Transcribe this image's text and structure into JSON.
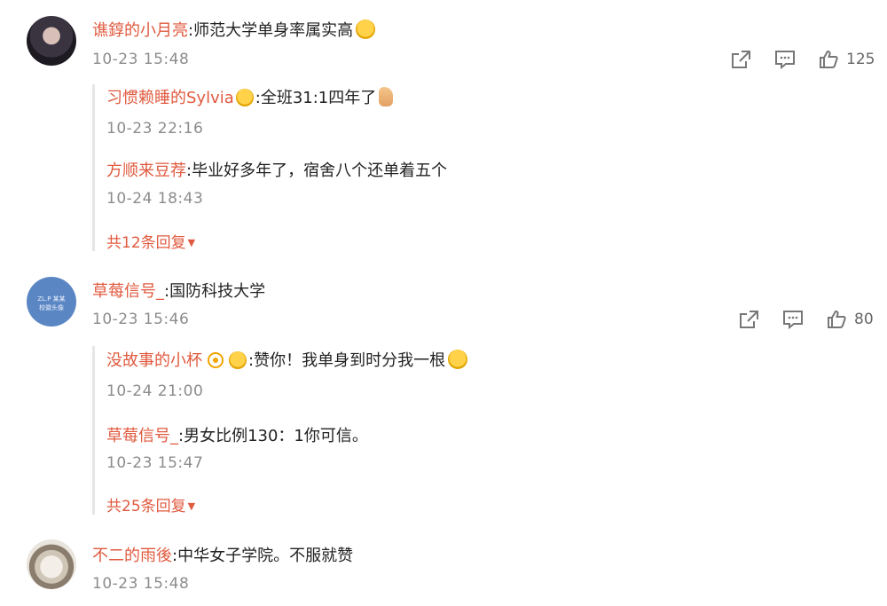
{
  "comments": [
    {
      "username": "谯錞的小月亮",
      "text": ":师范大学单身率属实高",
      "time": "10-23 15:48",
      "likes": "125",
      "replies": [
        {
          "username": "习惯赖睡的Sylvia",
          "text": ":全班31:1四年了",
          "time": "10-23 22:16"
        },
        {
          "username": "方顺来豆荐",
          "text": ":毕业好多年了，宿舍八个还单着五个",
          "time": "10-24 18:43"
        }
      ],
      "more_replies": "共12条回复"
    },
    {
      "username": "草莓信号_",
      "text": ":国防科技大学",
      "time": "10-23 15:46",
      "likes": "80",
      "avatar_text": "ZL.P 某某\n校徽头像",
      "replies": [
        {
          "username": "没故事的小杯",
          "text": ":赞你！我单身到时分我一根",
          "time": "10-24 21:00"
        },
        {
          "username": "草莓信号_",
          "text": ":男女比例130：1你可信。",
          "time": "10-23 15:47"
        }
      ],
      "more_replies": "共25条回复"
    },
    {
      "username": "不二的雨後",
      "text": ":中华女子学院。不服就赞",
      "time": "10-23 15:48"
    }
  ],
  "icons": {
    "share": "share-icon",
    "comment": "comment-icon",
    "like": "thumbs-up-icon",
    "expand": "chevron-down-icon"
  },
  "colors": {
    "username": "#e05a3f",
    "time": "#8c8c8c",
    "thread_bar": "#e6e6e6"
  }
}
